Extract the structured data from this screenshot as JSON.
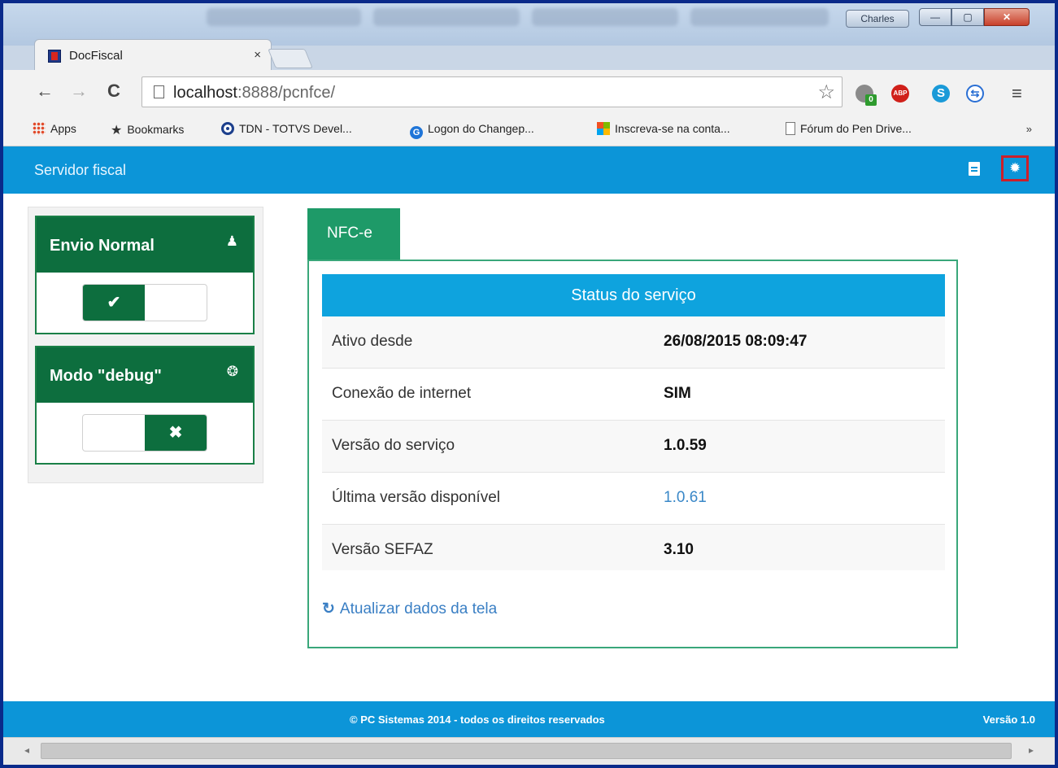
{
  "window": {
    "user_button": "Charles",
    "minimize": "—",
    "maximize": "▢",
    "close": "✕"
  },
  "tab": {
    "title": "DocFiscal",
    "close": "×"
  },
  "toolbar": {
    "back": "←",
    "forward": "→",
    "reload": "C",
    "url_host": "localhost",
    "url_port": ":8888/pcnfce/",
    "star": "☆",
    "abp_label": "ABP",
    "skype_label": "S",
    "sync_label": "⇆",
    "badge_count": "0",
    "menu": "≡"
  },
  "bookmarks": {
    "items": [
      {
        "label": "Apps",
        "icon": "apps-grid-icon"
      },
      {
        "label": "Bookmarks",
        "icon": "star-icon"
      },
      {
        "label": "TDN - TOTVS Devel...",
        "icon": "tdn-icon"
      },
      {
        "label": "Logon do Changep...",
        "icon": "g-icon"
      },
      {
        "label": "Inscreva-se na conta...",
        "icon": "microsoft-icon"
      },
      {
        "label": "Fórum do Pen Drive...",
        "icon": "page-icon"
      }
    ],
    "more": "»"
  },
  "app": {
    "brand": "Servidor fiscal",
    "cards": [
      {
        "title": "Envio Normal",
        "icon": "user-icon",
        "toggle_on": true,
        "knob": "✔"
      },
      {
        "title": "Modo \"debug\"",
        "icon": "bug-icon",
        "toggle_on": false,
        "knob": "✖"
      }
    ],
    "tab": "NFC-e",
    "status_header": "Status do serviço",
    "rows": [
      {
        "label": "Ativo desde",
        "value": "26/08/2015 08:09:47"
      },
      {
        "label": "Conexão de internet",
        "value": "SIM"
      },
      {
        "label": "Versão do serviço",
        "value": "1.0.59"
      },
      {
        "label": "Última versão disponível",
        "value": "1.0.61"
      },
      {
        "label": "Versão SEFAZ",
        "value": "3.10"
      }
    ],
    "refresh_icon": "↻",
    "refresh_label": "Atualizar dados da tela",
    "footer_copy": "© PC Sistemas 2014 - todos os direitos reservados",
    "footer_version": "Versão 1.0"
  },
  "scrollbar": {
    "left": "◂",
    "right": "▸"
  },
  "colors": {
    "navbar": "#0c95d8",
    "card_green": "#0d6e3e",
    "tab_green": "#1e9a68",
    "status_blue": "#0ea3de",
    "link_blue": "#3a88c8",
    "highlight_red": "#cc1f2a"
  }
}
